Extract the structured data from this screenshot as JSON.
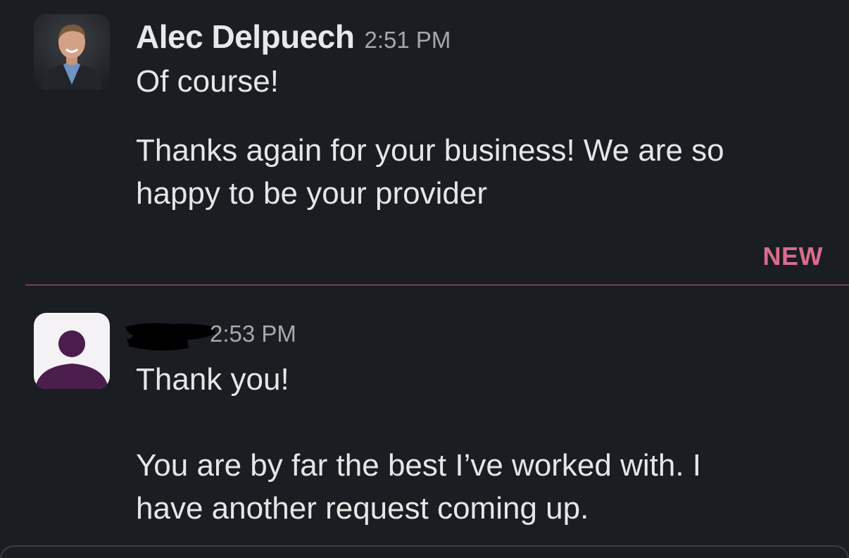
{
  "messages": [
    {
      "sender": "Alec Delpuech",
      "time": "2:51 PM",
      "avatar": "profile-photo",
      "lines": [
        "Of course!",
        "Thanks again for your business! We are so",
        "happy to be your provider"
      ]
    },
    {
      "sender": "",
      "time": "2:53 PM",
      "avatar": "default-user-icon",
      "lines": [
        "Thank you!",
        "You are by far the best I’ve worked with. I",
        "have another request coming up."
      ]
    }
  ],
  "divider": {
    "label": "NEW"
  },
  "colors": {
    "background": "#1a1d21",
    "text": "#e6e6e7",
    "timestamp": "#a6a8ab",
    "new_accent": "#d96c8f",
    "default_avatar": "#4a1d4d"
  }
}
